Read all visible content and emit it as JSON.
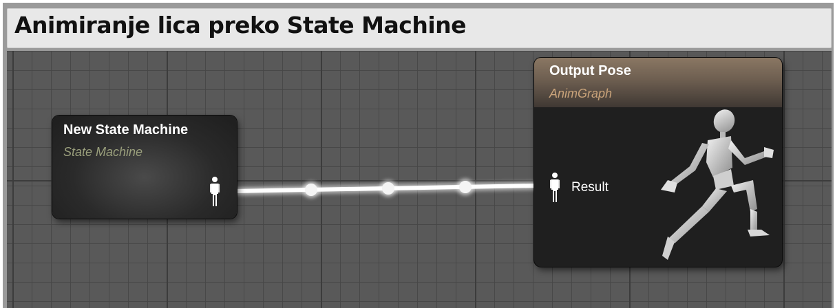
{
  "caption": {
    "title": "Animiranje lica preko State Machine"
  },
  "state_machine_node": {
    "title": "New State Machine",
    "subtitle": "State Machine",
    "output_pin_icon": "pose-pin-icon"
  },
  "output_pose_node": {
    "title": "Output Pose",
    "subtitle": "AnimGraph",
    "input_pin_icon": "pose-pin-icon",
    "pin_label": "Result",
    "preview_icon": "running-mannequin-icon"
  },
  "colors": {
    "graph_background": "#595959",
    "node_body": "#1f1f1f",
    "output_header": "#8a7763",
    "state_machine_subtitle": "#9a9f7c",
    "anim_graph_subtitle": "#c9a37a",
    "wire": "#ffffff"
  }
}
